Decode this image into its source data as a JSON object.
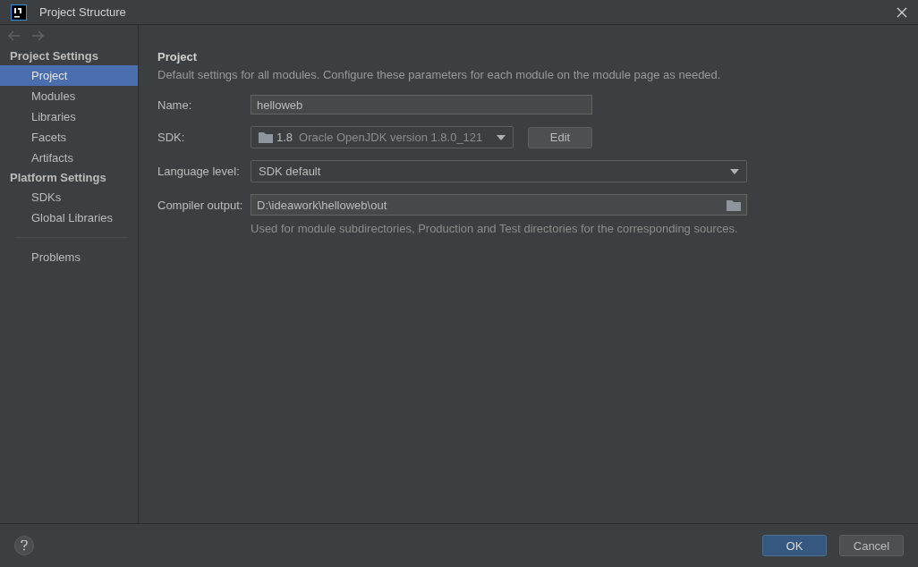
{
  "window": {
    "title": "Project Structure"
  },
  "sidebar": {
    "sections": [
      {
        "title": "Project Settings",
        "items": [
          {
            "label": "Project",
            "selected": true
          },
          {
            "label": "Modules",
            "selected": false
          },
          {
            "label": "Libraries",
            "selected": false
          },
          {
            "label": "Facets",
            "selected": false
          },
          {
            "label": "Artifacts",
            "selected": false
          }
        ]
      },
      {
        "title": "Platform Settings",
        "items": [
          {
            "label": "SDKs",
            "selected": false
          },
          {
            "label": "Global Libraries",
            "selected": false
          }
        ]
      }
    ],
    "extra_items": [
      {
        "label": "Problems",
        "selected": false
      }
    ]
  },
  "content": {
    "heading": "Project",
    "description": "Default settings for all modules. Configure these parameters for each module on the module page as needed.",
    "name": {
      "label": "Name:",
      "value": "helloweb"
    },
    "sdk": {
      "label": "SDK:",
      "version": "1.8",
      "detail": "Oracle OpenJDK version 1.8.0_121",
      "button": "Edit"
    },
    "language_level": {
      "label": "Language level:",
      "value": "SDK default"
    },
    "compiler_output": {
      "label": "Compiler output:",
      "value": "D:\\ideawork\\helloweb\\out",
      "hint": "Used for module subdirectories, Production and Test directories for the corresponding sources."
    }
  },
  "buttons": [
    {
      "label": "OK",
      "kind": "primary"
    },
    {
      "label": "Cancel",
      "kind": "secondary"
    }
  ]
}
